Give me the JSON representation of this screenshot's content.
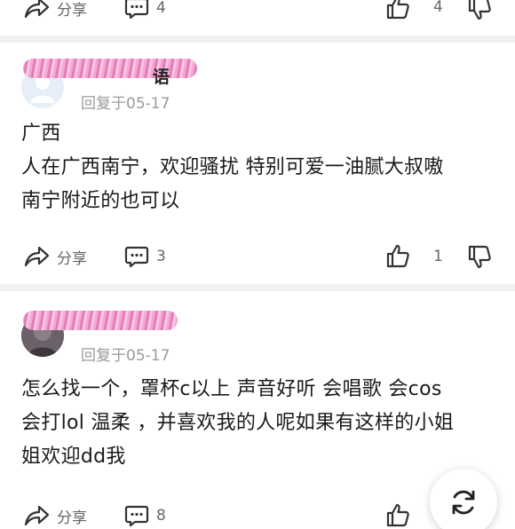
{
  "top_actions": {
    "share_label": "分享",
    "comment_count": "4",
    "like_count": "4"
  },
  "posts": [
    {
      "name_visible_suffix": "语",
      "reply_time": "回复于05-17",
      "content_lines": [
        "广西",
        "人在广西南宁，欢迎骚扰 特别可爱一油腻大叔嗷",
        "南宁附近的也可以"
      ],
      "share_label": "分享",
      "comment_count": "3",
      "like_count": "1"
    },
    {
      "reply_time": "回复于05-17",
      "content_lines": [
        "怎么找一个，罩杯c以上 声音好听 会唱歌 会cos",
        "会打lol 温柔 ，并喜欢我的人呢如果有这样的小姐",
        "姐欢迎dd我"
      ],
      "share_label": "分享",
      "comment_count": "8"
    }
  ],
  "floating_button": {
    "icon": "refresh-icon"
  }
}
